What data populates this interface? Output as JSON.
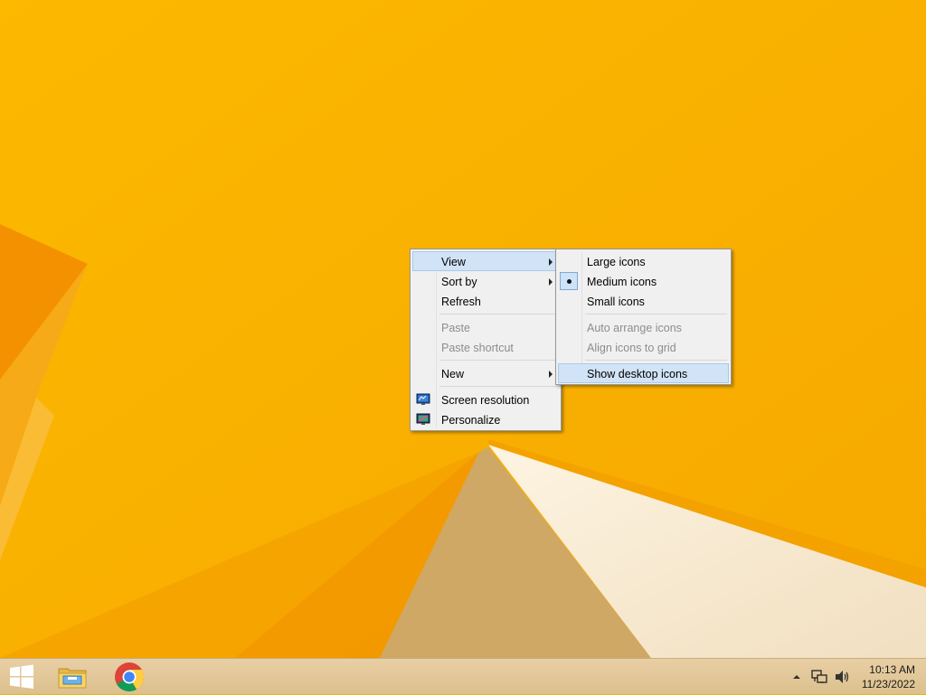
{
  "desktop": {
    "context_menu": {
      "items": [
        {
          "label": "View",
          "submenu": true,
          "state": "highlighted"
        },
        {
          "label": "Sort by",
          "submenu": true
        },
        {
          "label": "Refresh"
        },
        {
          "label": "Paste",
          "state": "disabled"
        },
        {
          "label": "Paste shortcut",
          "state": "disabled"
        },
        {
          "label": "New",
          "submenu": true
        },
        {
          "label": "Screen resolution",
          "icon": "screen-resolution-icon"
        },
        {
          "label": "Personalize",
          "icon": "personalize-icon"
        }
      ]
    },
    "view_submenu": {
      "items": [
        {
          "label": "Large icons"
        },
        {
          "label": "Medium icons",
          "checked": true
        },
        {
          "label": "Small icons"
        },
        {
          "label": "Auto arrange icons",
          "state": "disabled"
        },
        {
          "label": "Align icons to grid",
          "state": "disabled"
        },
        {
          "label": "Show desktop icons",
          "state": "highlighted"
        }
      ]
    }
  },
  "taskbar": {
    "pinned": [
      {
        "icon": "windows-start-icon"
      },
      {
        "icon": "file-explorer-icon"
      },
      {
        "icon": "chrome-icon"
      }
    ],
    "tray": {
      "icons": [
        "show-hidden-icons-chevron",
        "network-icon",
        "volume-icon"
      ],
      "time": "10:13 AM",
      "date": "11/23/2022"
    }
  },
  "colors": {
    "wallpaper": "#f7b500",
    "menu_bg": "#f0f0f0",
    "highlight": "#d1e3f6",
    "taskbar": "#e2c896"
  }
}
